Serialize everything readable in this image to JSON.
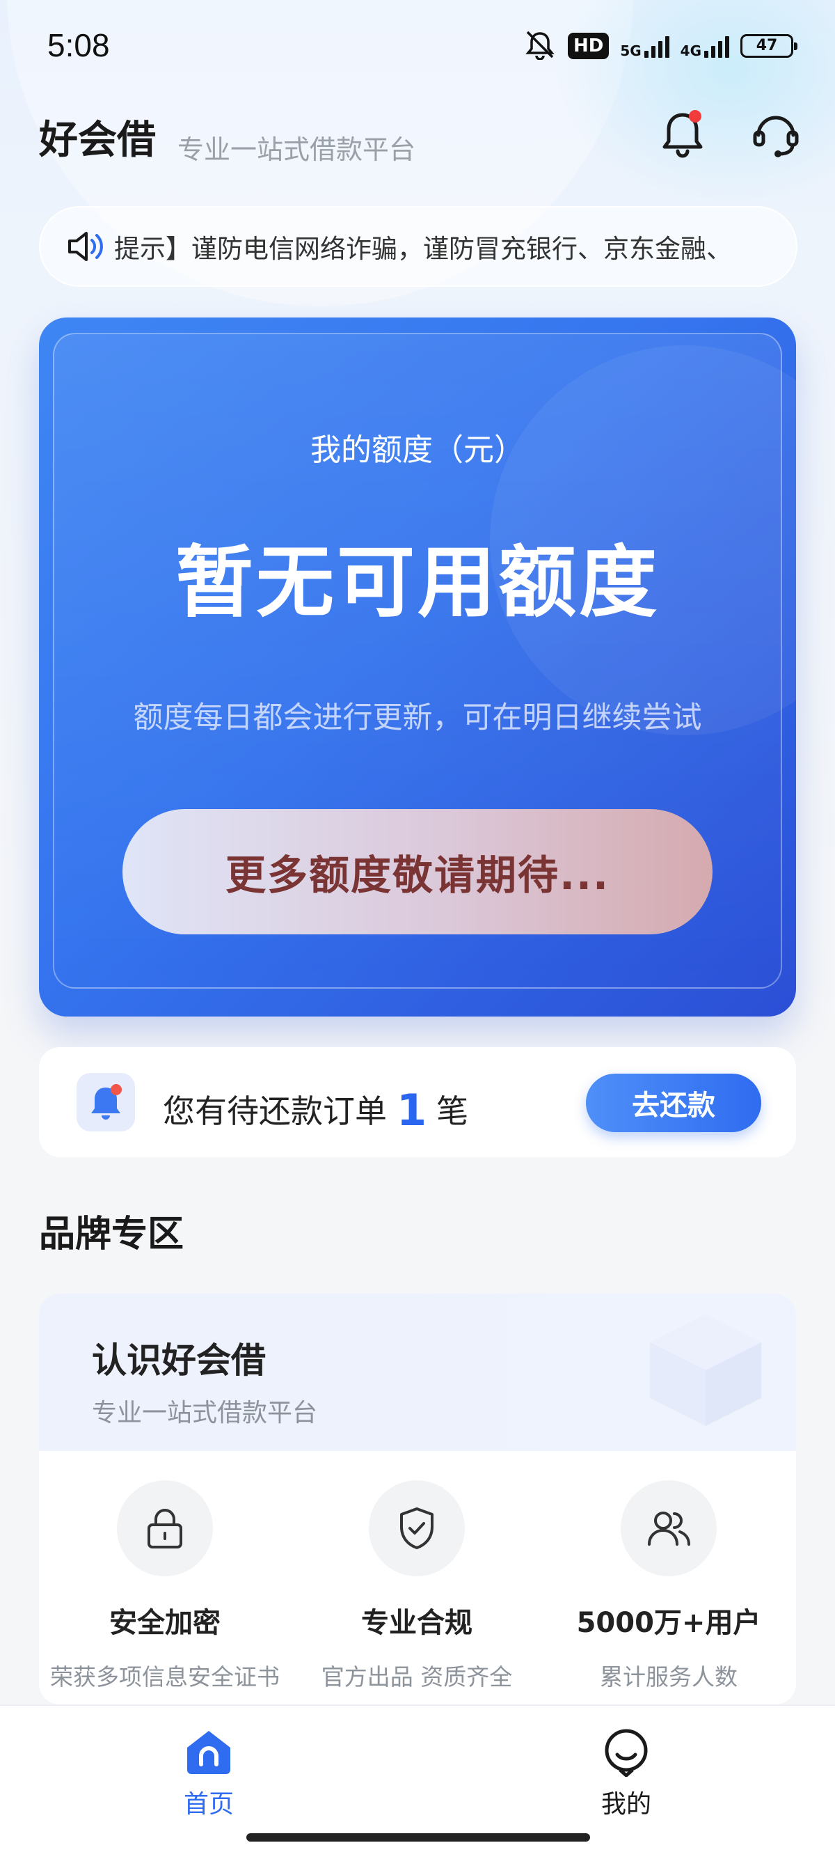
{
  "status_bar": {
    "time": "5:08",
    "hd_label": "HD",
    "network_1": "5G",
    "network_2": "4G",
    "battery": "47"
  },
  "header": {
    "app_name": "好会借",
    "tagline": "专业一站式借款平台",
    "bell_icon": "bell-icon",
    "service_icon": "headset-icon"
  },
  "notice": {
    "text": "提示】谨防电信网络诈骗，谨防冒充银行、京东金融、"
  },
  "quota": {
    "label": "我的额度（元）",
    "amount_text": "暂无可用额度",
    "note": "额度每日都会进行更新，可在明日继续尝试",
    "button_label": "更多额度敬请期待..."
  },
  "repay": {
    "prefix": "您有待还款订单",
    "count": "1",
    "suffix": "笔",
    "button_label": "去还款"
  },
  "brand": {
    "section_title": "品牌专区",
    "card_title": "认识好会借",
    "card_subtitle": "专业一站式借款平台",
    "features": [
      {
        "icon": "lock-icon",
        "title": "安全加密",
        "desc": "荣获多项信息安全证书"
      },
      {
        "icon": "shield-check-icon",
        "title": "专业合规",
        "desc": "官方出品 资质齐全"
      },
      {
        "icon": "users-icon",
        "title": "5000万+用户",
        "desc": "累计服务人数"
      }
    ]
  },
  "tabbar": {
    "tabs": [
      {
        "label": "首页",
        "icon": "home-icon",
        "active": true
      },
      {
        "label": "我的",
        "icon": "profile-icon",
        "active": false
      }
    ]
  },
  "colors": {
    "accent": "#2f6cf0",
    "card_gradient_start": "#3f86f4",
    "card_gradient_end": "#2b4fd6",
    "button_text": "#7a3434"
  }
}
